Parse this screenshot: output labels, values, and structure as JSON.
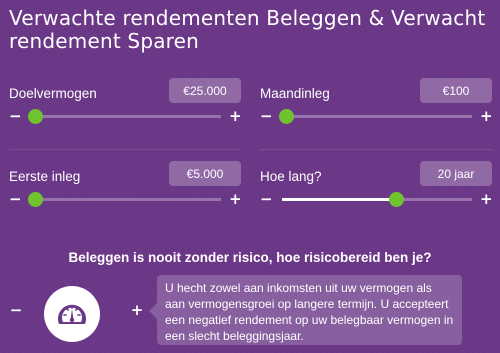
{
  "title": "Verwachte rendementen Beleggen & Verwacht rendement Sparen",
  "sliders": {
    "doelvermogen": {
      "label": "Doelvermogen",
      "value": "€25.000",
      "minus": "−",
      "plus": "+",
      "level": 0.02
    },
    "maandinleg": {
      "label": "Maandinleg",
      "value": "€100",
      "minus": "−",
      "plus": "+",
      "level": 0.02
    },
    "eerste_inleg": {
      "label": "Eerste inleg",
      "value": "€5.000",
      "minus": "−",
      "plus": "+",
      "level": 0.02
    },
    "hoe_lang": {
      "label": "Hoe lang?",
      "value": "20 jaar",
      "minus": "−",
      "plus": "+",
      "level": 0.6
    }
  },
  "risk": {
    "question": "Beleggen is nooit zonder risico, hoe risicobereid ben je?",
    "minus": "−",
    "plus": "+",
    "icon": "speedometer-icon",
    "description": "U hecht zowel aan inkomsten uit uw vermogen als aan vermogensgroei op langere termijn. U accepteert een negatief rendement op uw belegbaar vermogen in een slecht beleggingsjaar."
  },
  "colors": {
    "background": "#6a3686",
    "thumb": "#6ec32e",
    "text": "#ffffff"
  }
}
